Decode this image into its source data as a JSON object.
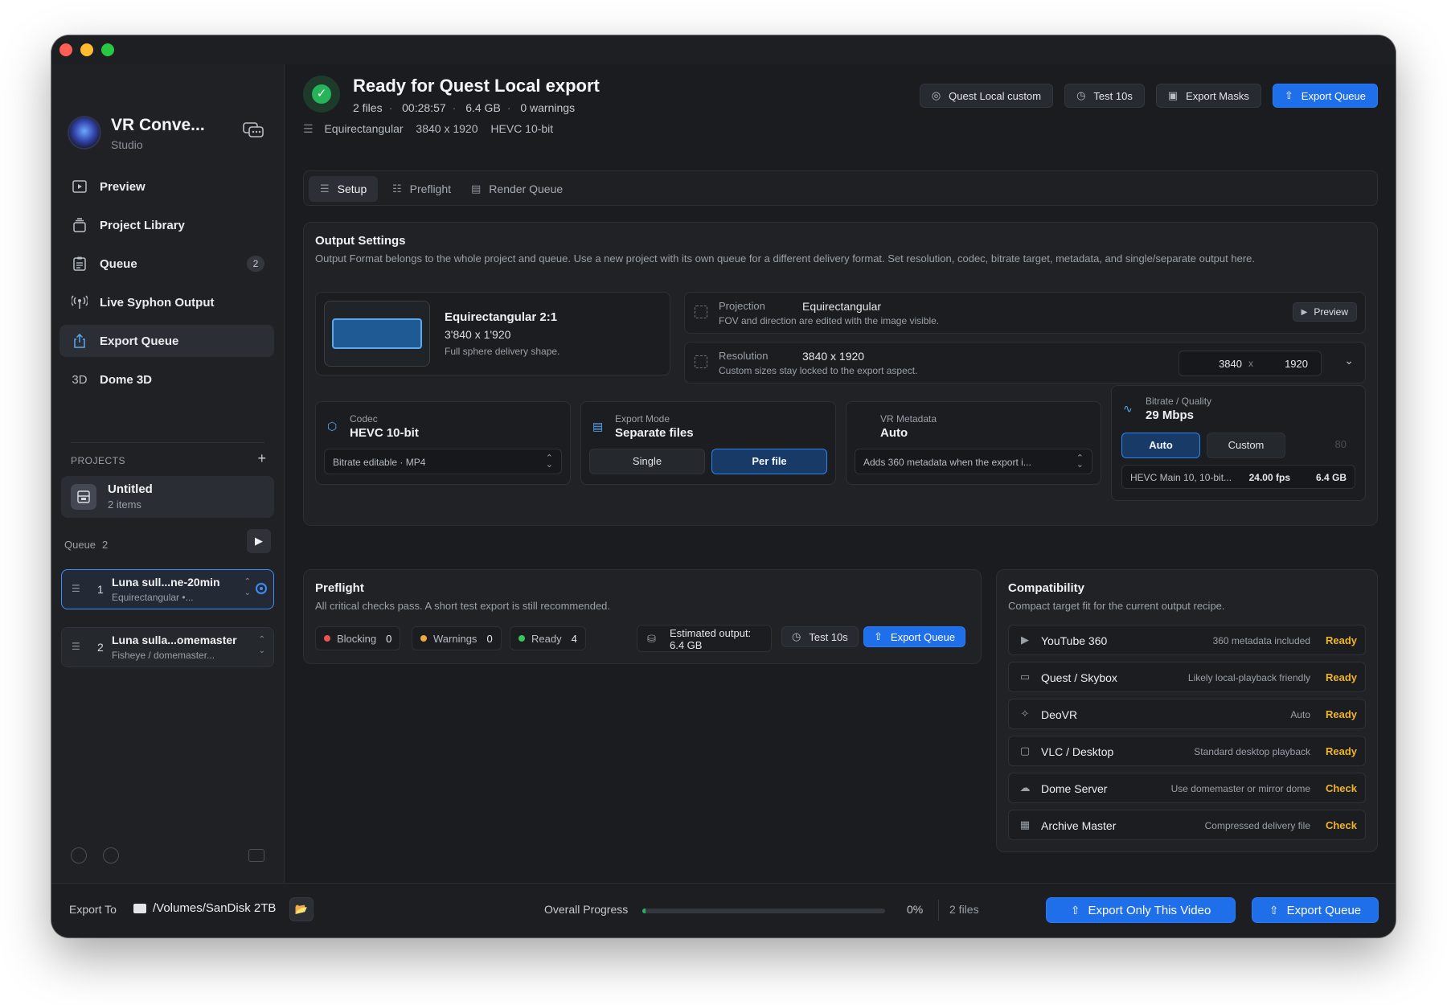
{
  "app": {
    "title": "VR Conve...",
    "subtitle": "Studio"
  },
  "nav": {
    "items": [
      {
        "label": "Preview",
        "icon": "play-square-icon"
      },
      {
        "label": "Project Library",
        "icon": "stack-icon"
      },
      {
        "label": "Queue",
        "icon": "clipboard-icon",
        "badge": "2"
      },
      {
        "label": "Live Syphon Output",
        "icon": "broadcast-icon"
      },
      {
        "label": "Export Queue",
        "icon": "share-icon",
        "active": true
      },
      {
        "label": "Dome 3D",
        "icon": "3d-text-icon",
        "glyph": "3D"
      }
    ]
  },
  "projects": {
    "heading": "PROJECTS",
    "current": {
      "name": "Untitled",
      "sub": "2 items"
    }
  },
  "queue": {
    "label": "Queue",
    "count": "2",
    "items": [
      {
        "num": "1",
        "name": "Luna sull...ne-20min",
        "sub": "Equirectangular  •..."
      },
      {
        "num": "2",
        "name": "Luna sulla...omemaster",
        "sub": "Fisheye / domemaster..."
      }
    ]
  },
  "status": {
    "title": "Ready for Quest Local export",
    "files": "2 files",
    "duration": "00:28:57",
    "size": "6.4 GB",
    "warnings": "0 warnings",
    "format_projection": "Equirectangular",
    "format_resolution": "3840 x 1920",
    "format_codec": "HEVC 10-bit"
  },
  "top_actions": {
    "preset": "Quest Local custom",
    "test": "Test 10s",
    "masks": "Export Masks",
    "export": "Export Queue"
  },
  "tabs": [
    {
      "label": "Setup",
      "active": true
    },
    {
      "label": "Preflight"
    },
    {
      "label": "Render Queue"
    }
  ],
  "output": {
    "title": "Output Settings",
    "desc": "Output Format belongs to the whole project and queue. Use a new project with its own queue for a different delivery format. Set resolution, codec, bitrate target, metadata, and single/separate output here.",
    "format": {
      "name": "Equirectangular 2:1",
      "dims": "3'840 x 1'920",
      "shape": "Full sphere delivery shape."
    },
    "projection": {
      "label": "Projection",
      "value": "Equirectangular",
      "help": "FOV and direction are edited with the image visible.",
      "button": "Preview"
    },
    "resolution": {
      "label": "Resolution",
      "value": "3840 x 1920",
      "help": "Custom sizes stay locked to the export aspect.",
      "width": "3840",
      "x": "x",
      "height": "1920"
    },
    "codec": {
      "label": "Codec",
      "value": "HEVC 10-bit",
      "select": "Bitrate editable · MP4"
    },
    "export_mode": {
      "label": "Export Mode",
      "value": "Separate files",
      "options": [
        "Single",
        "Per file"
      ],
      "selected": "Per file"
    },
    "metadata": {
      "label": "VR Metadata",
      "value": "Auto",
      "select": "Adds 360 metadata when the export i..."
    },
    "bitrate": {
      "label": "Bitrate / Quality",
      "value": "29 Mbps",
      "options": [
        "Auto",
        "Custom"
      ],
      "custom_value": "80",
      "codec_detail": "HEVC Main 10, 10-bit...",
      "fps": "24.00 fps",
      "size": "6.4 GB"
    }
  },
  "preflight": {
    "title": "Preflight",
    "desc": "All critical checks pass. A short test export is still recommended.",
    "blocking": {
      "label": "Blocking",
      "count": "0"
    },
    "warnings": {
      "label": "Warnings",
      "count": "0"
    },
    "ready": {
      "label": "Ready",
      "count": "4"
    },
    "estimate_label": "Estimated output:",
    "estimate_value": "6.4 GB",
    "test": "Test 10s",
    "export": "Export Queue"
  },
  "compat": {
    "title": "Compatibility",
    "desc": "Compact target fit for the current output recipe.",
    "rows": [
      {
        "name": "YouTube 360",
        "note": "360 metadata included",
        "status": "Ready",
        "icon": "play-square-icon"
      },
      {
        "name": "Quest / Skybox",
        "note": "Likely local-playback friendly",
        "status": "Ready",
        "icon": "headset-icon"
      },
      {
        "name": "DeoVR",
        "note": "Auto",
        "status": "Ready",
        "icon": "target-icon"
      },
      {
        "name": "VLC / Desktop",
        "note": "Standard desktop playback",
        "status": "Ready",
        "icon": "monitor-icon"
      },
      {
        "name": "Dome Server",
        "note": "Use domemaster or mirror dome",
        "status": "Check",
        "icon": "server-icon"
      },
      {
        "name": "Archive Master",
        "note": "Compressed delivery file",
        "status": "Check",
        "icon": "archive-icon"
      }
    ]
  },
  "footer": {
    "export_to": "Export To",
    "path": "/Volumes/SanDisk 2TB",
    "progress_label": "Overall Progress",
    "progress_percent": 0,
    "progress_text": "0%",
    "files": "2 files",
    "export_one": "Export Only This Video",
    "export_queue": "Export Queue"
  },
  "colors": {
    "accent": "#1f6fea",
    "ready": "#f0b429",
    "success": "#27b35a",
    "blocking": "#ef5350",
    "warning": "#f0a93a",
    "ready_dot": "#34c759"
  }
}
